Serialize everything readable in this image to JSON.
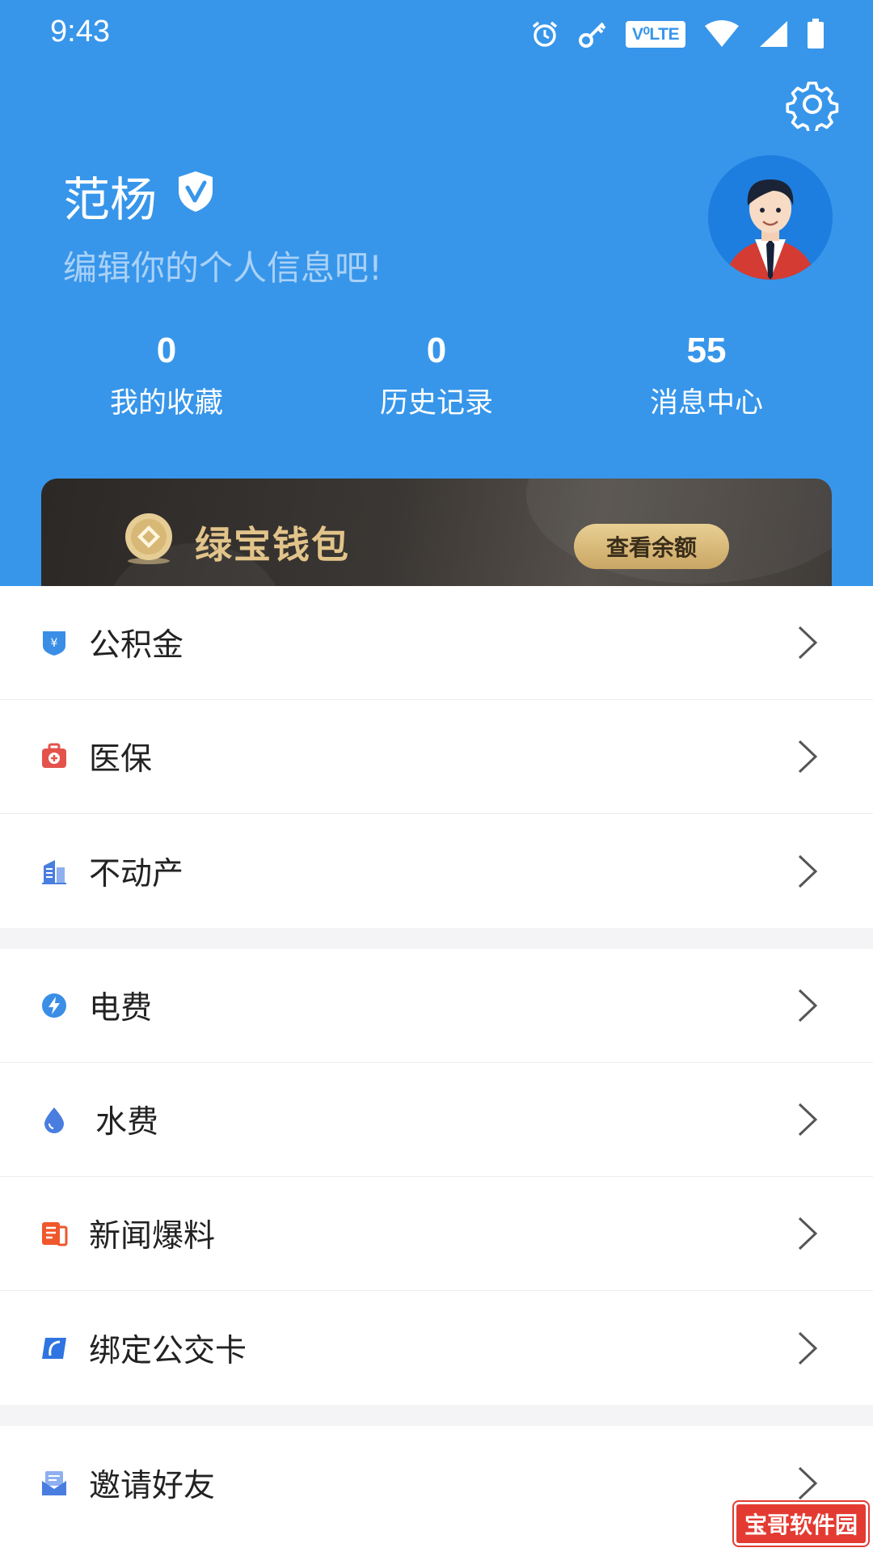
{
  "status_bar": {
    "time": "9:43",
    "icons": [
      "alarm-icon",
      "key-icon",
      "volte-icon",
      "wifi-icon",
      "signal-icon",
      "battery-icon"
    ],
    "volte_text": "V⁰LTE"
  },
  "header": {
    "user_name": "范杨",
    "profile_hint": "编辑你的个人信息吧!",
    "background_color": "#3796ea"
  },
  "stats": [
    {
      "value": "0",
      "label": "我的收藏"
    },
    {
      "value": "0",
      "label": "历史记录"
    },
    {
      "value": "55",
      "label": "消息中心"
    }
  ],
  "wallet": {
    "title": "绿宝钱包",
    "button_label": "查看余额"
  },
  "menu": {
    "group1": [
      {
        "label": "公积金",
        "icon": "fund-icon"
      },
      {
        "label": "医保",
        "icon": "medical-kit-icon"
      },
      {
        "label": "不动产",
        "icon": "building-icon"
      }
    ],
    "group2": [
      {
        "label": "电费",
        "icon": "lightning-icon"
      },
      {
        "label": "水费",
        "icon": "water-drop-icon"
      },
      {
        "label": "新闻爆料",
        "icon": "news-icon"
      },
      {
        "label": "绑定公交卡",
        "icon": "bus-card-icon"
      }
    ],
    "group3": [
      {
        "label": "邀请好友",
        "icon": "invite-envelope-icon"
      }
    ]
  },
  "watermark": "宝哥软件园"
}
